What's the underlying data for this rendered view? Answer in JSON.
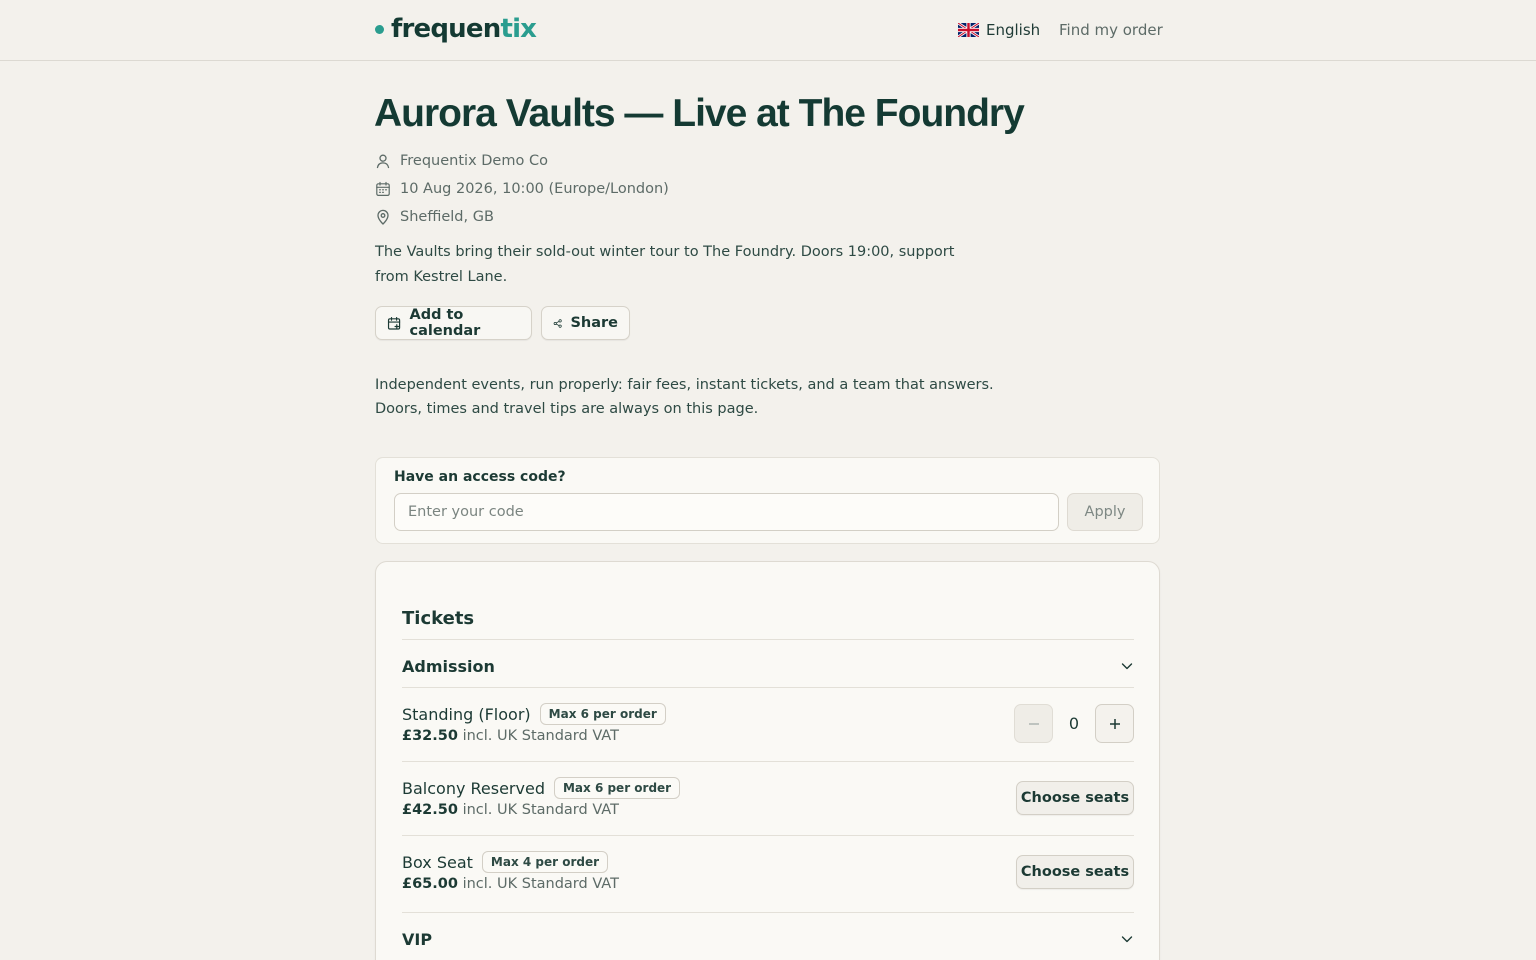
{
  "header": {
    "logo_main": "frequen",
    "logo_accent": "tix",
    "language": "English",
    "find_order": "Find my order"
  },
  "event": {
    "title": "Aurora Vaults — Live at The Foundry",
    "organiser": "Frequentix Demo Co",
    "datetime": "10 Aug 2026, 10:00 (Europe/London)",
    "location": "Sheffield, GB",
    "description": "The Vaults bring their sold-out winter tour to The Foundry. Doors 19:00, support from Kestrel Lane.",
    "add_to_calendar": "Add to calendar",
    "share": "Share"
  },
  "intro": {
    "line1": "Independent events, run properly: fair fees, instant tickets, and a team that answers.",
    "line2": "Doors, times and travel tips are always on this page."
  },
  "access_code": {
    "label": "Have an access code?",
    "placeholder": "Enter your code",
    "value": "",
    "apply": "Apply"
  },
  "tickets": {
    "title": "Tickets",
    "sections": [
      {
        "label": "Admission",
        "expanded": true,
        "items": [
          {
            "name": "Standing (Floor)",
            "badge": "Max 6 per order",
            "price": "£32.50",
            "tax": "incl. UK Standard VAT",
            "action": "stepper",
            "quantity": "0"
          },
          {
            "name": "Balcony Reserved",
            "badge": "Max 6 per order",
            "price": "£42.50",
            "tax": "incl. UK Standard VAT",
            "action": "Choose seats"
          },
          {
            "name": "Box Seat",
            "badge": "Max 4 per order",
            "price": "£65.00",
            "tax": "incl. UK Standard VAT",
            "action": "Choose seats"
          }
        ]
      },
      {
        "label": "VIP",
        "expanded": false
      }
    ]
  },
  "colors": {
    "background": "#f3f1ec",
    "brand_dark": "#143a33",
    "brand_accent": "#2a9d8f",
    "card": "#faf9f5",
    "muted_text": "#5d6b67"
  },
  "icons": {
    "organiser": "user-icon",
    "date": "calendar-icon",
    "location": "map-pin-icon",
    "add_to_calendar": "calendar-plus-icon",
    "share": "share-icon",
    "language": "uk-flag-icon",
    "section_toggle": "chevron-down-icon"
  }
}
